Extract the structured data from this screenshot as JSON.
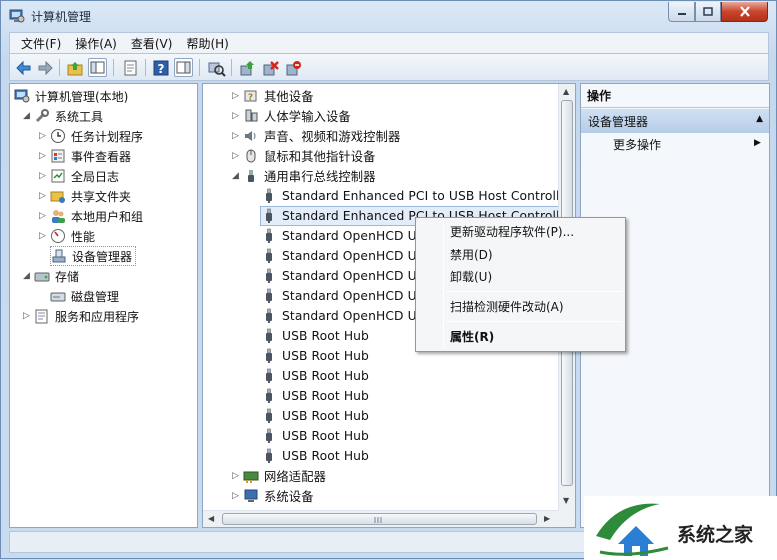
{
  "window": {
    "title": "计算机管理"
  },
  "menubar": [
    {
      "label": "文件(F)"
    },
    {
      "label": "操作(A)"
    },
    {
      "label": "查看(V)"
    },
    {
      "label": "帮助(H)"
    }
  ],
  "toolbar": {
    "icons": [
      "back-arrow-icon",
      "forward-arrow-icon",
      "up-folder-icon",
      "show-hide-console-tree-icon",
      "properties-icon",
      "help-icon",
      "action-pane-icon",
      "scan-hardware-icon",
      "update-driver-icon",
      "uninstall-icon",
      "disable-device-icon"
    ]
  },
  "left_tree": [
    {
      "label": "计算机管理(本地)",
      "level": 0,
      "expander": "",
      "icon": "computer-management-icon"
    },
    {
      "label": "系统工具",
      "level": 1,
      "expander": "◢",
      "icon": "system-tools-icon"
    },
    {
      "label": "任务计划程序",
      "level": 2,
      "expander": "▷",
      "icon": "task-scheduler-icon"
    },
    {
      "label": "事件查看器",
      "level": 2,
      "expander": "▷",
      "icon": "event-viewer-icon"
    },
    {
      "label": "全局日志",
      "level": 2,
      "expander": "▷",
      "icon": "global-log-icon"
    },
    {
      "label": "共享文件夹",
      "level": 2,
      "expander": "▷",
      "icon": "shared-folders-icon"
    },
    {
      "label": "本地用户和组",
      "level": 2,
      "expander": "▷",
      "icon": "local-users-icon"
    },
    {
      "label": "性能",
      "level": 2,
      "expander": "▷",
      "icon": "performance-icon"
    },
    {
      "label": "设备管理器",
      "level": 2,
      "expander": "",
      "icon": "device-manager-icon",
      "selected": true
    },
    {
      "label": "存储",
      "level": 1,
      "expander": "◢",
      "icon": "storage-icon"
    },
    {
      "label": "磁盘管理",
      "level": 2,
      "expander": "",
      "icon": "disk-management-icon"
    },
    {
      "label": "服务和应用程序",
      "level": 1,
      "expander": "▷",
      "icon": "services-apps-icon"
    }
  ],
  "device_tree": [
    {
      "label": "其他设备",
      "kind": "category",
      "expander": "▷",
      "icon": "unknown-device-icon"
    },
    {
      "label": "人体学输入设备",
      "kind": "category",
      "expander": "▷",
      "icon": "hid-icon"
    },
    {
      "label": "声音、视频和游戏控制器",
      "kind": "category",
      "expander": "▷",
      "icon": "speaker-icon"
    },
    {
      "label": "鼠标和其他指针设备",
      "kind": "category",
      "expander": "▷",
      "icon": "mouse-icon"
    },
    {
      "label": "通用串行总线控制器",
      "kind": "category",
      "expander": "◢",
      "icon": "usb-icon"
    },
    {
      "label": "Standard Enhanced PCI to USB Host Controller",
      "kind": "device",
      "icon": "usb-plug-icon"
    },
    {
      "label": "Standard Enhanced PCI to USB Host Controller",
      "kind": "device",
      "icon": "usb-plug-icon",
      "highlighted": true
    },
    {
      "label": "Standard OpenHCD USB Host Controller",
      "kind": "device",
      "icon": "usb-plug-icon"
    },
    {
      "label": "Standard OpenHCD USB Host Controller",
      "kind": "device",
      "icon": "usb-plug-icon"
    },
    {
      "label": "Standard OpenHCD USB Host Controller",
      "kind": "device",
      "icon": "usb-plug-icon"
    },
    {
      "label": "Standard OpenHCD USB Host Controller",
      "kind": "device",
      "icon": "usb-plug-icon"
    },
    {
      "label": "Standard OpenHCD USB Host Controller",
      "kind": "device",
      "icon": "usb-plug-icon"
    },
    {
      "label": "USB Root Hub",
      "kind": "device",
      "icon": "usb-plug-icon"
    },
    {
      "label": "USB Root Hub",
      "kind": "device",
      "icon": "usb-plug-icon"
    },
    {
      "label": "USB Root Hub",
      "kind": "device",
      "icon": "usb-plug-icon"
    },
    {
      "label": "USB Root Hub",
      "kind": "device",
      "icon": "usb-plug-icon"
    },
    {
      "label": "USB Root Hub",
      "kind": "device",
      "icon": "usb-plug-icon"
    },
    {
      "label": "USB Root Hub",
      "kind": "device",
      "icon": "usb-plug-icon"
    },
    {
      "label": "USB Root Hub",
      "kind": "device",
      "icon": "usb-plug-icon"
    },
    {
      "label": "网络适配器",
      "kind": "category",
      "expander": "▷",
      "icon": "network-adapter-icon"
    },
    {
      "label": "系统设备",
      "kind": "category",
      "expander": "▷",
      "icon": "system-devices-icon"
    }
  ],
  "context_menu": [
    {
      "label": "更新驱动程序软件(P)..."
    },
    {
      "label": "禁用(D)"
    },
    {
      "label": "卸载(U)"
    },
    {
      "label": "扫描检测硬件改动(A)"
    },
    {
      "label": "属性(R)",
      "bold": true
    }
  ],
  "actions_pane": {
    "title": "操作",
    "section": "设备管理器",
    "more": "更多操作"
  },
  "watermark": {
    "text": "系统之家"
  },
  "colors": {
    "accent": "#3a6ea5",
    "highlight": "#e3edf9",
    "watermark_green": "#2e8b3a"
  }
}
